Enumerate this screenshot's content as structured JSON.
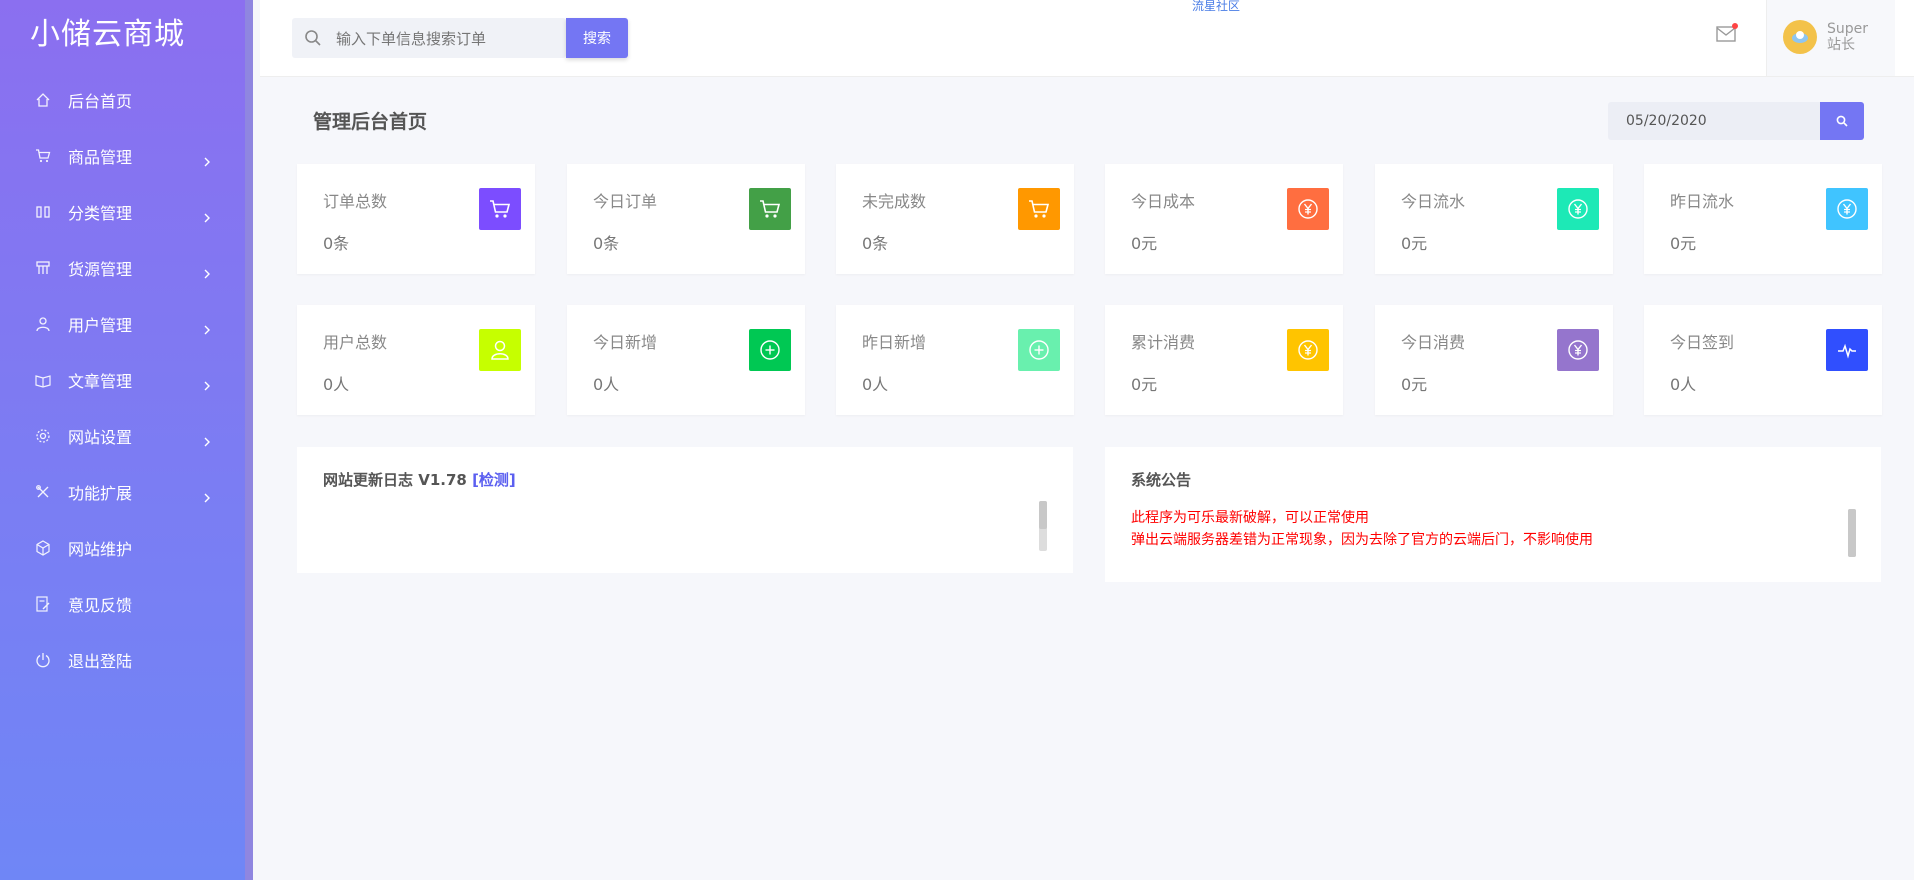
{
  "brand": "小储云商城",
  "top_note": "流星社区",
  "search": {
    "placeholder": "输入下单信息搜索订单",
    "button": "搜索"
  },
  "user": {
    "name": "Super",
    "role": "站长"
  },
  "sidebar": {
    "items": [
      {
        "label": "后台首页",
        "icon": "home-icon",
        "arrow": false
      },
      {
        "label": "商品管理",
        "icon": "cart-icon",
        "arrow": true
      },
      {
        "label": "分类管理",
        "icon": "columns-icon",
        "arrow": true
      },
      {
        "label": "货源管理",
        "icon": "store-icon",
        "arrow": true
      },
      {
        "label": "用户管理",
        "icon": "user-icon",
        "arrow": true
      },
      {
        "label": "文章管理",
        "icon": "book-icon",
        "arrow": true
      },
      {
        "label": "网站设置",
        "icon": "gear-icon",
        "arrow": true
      },
      {
        "label": "功能扩展",
        "icon": "tools-icon",
        "arrow": true
      },
      {
        "label": "网站维护",
        "icon": "cube-icon",
        "arrow": false
      },
      {
        "label": "意见反馈",
        "icon": "feedback-icon",
        "arrow": false
      },
      {
        "label": "退出登陆",
        "icon": "power-icon",
        "arrow": false
      }
    ]
  },
  "main": {
    "title": "管理后台首页",
    "date": "05/20/2020",
    "stats": [
      {
        "label": "订单总数",
        "value": "0条",
        "icon": "cart-icon",
        "color": "#7c4dff"
      },
      {
        "label": "今日订单",
        "value": "0条",
        "icon": "cart-icon",
        "color": "#43a047"
      },
      {
        "label": "未完成数",
        "value": "0条",
        "icon": "cart-icon",
        "color": "#ff9800"
      },
      {
        "label": "今日成本",
        "value": "0元",
        "icon": "yen-icon",
        "color": "#ff6e40"
      },
      {
        "label": "今日流水",
        "value": "0元",
        "icon": "yen-icon",
        "color": "#1de9b6"
      },
      {
        "label": "昨日流水",
        "value": "0元",
        "icon": "yen-icon",
        "color": "#40c4ff"
      },
      {
        "label": "用户总数",
        "value": "0人",
        "icon": "user-icon",
        "color": "#c6ff00"
      },
      {
        "label": "今日新增",
        "value": "0人",
        "icon": "plus-icon",
        "color": "#00c853"
      },
      {
        "label": "昨日新增",
        "value": "0人",
        "icon": "plus-icon",
        "color": "#69f0ae"
      },
      {
        "label": "累计消费",
        "value": "0元",
        "icon": "yen-icon",
        "color": "#ffc400"
      },
      {
        "label": "今日消费",
        "value": "0元",
        "icon": "yen-icon",
        "color": "#9575cd"
      },
      {
        "label": "今日签到",
        "value": "0人",
        "icon": "pulse-icon",
        "color": "#304ffe"
      }
    ],
    "update_log": {
      "title": "网站更新日志 V1.78 ",
      "check": "[检测]"
    },
    "notice": {
      "title": "系统公告",
      "lines": [
        "此程序为可乐最新破解，可以正常使用",
        "弹出云端服务器差错为正常现象，因为去除了官方的云端后门，不影响使用"
      ]
    }
  }
}
